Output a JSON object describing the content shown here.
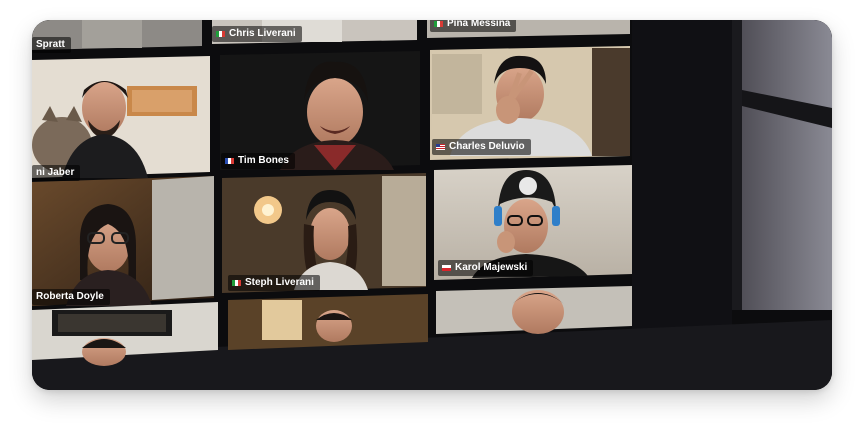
{
  "photo": {
    "subject": "video-call-grid-on-screen"
  },
  "participants": [
    {
      "name": "Spratt",
      "flag": "none"
    },
    {
      "name": "Chris Liverani",
      "flag": "it"
    },
    {
      "name": "Pina Messina",
      "flag": "it"
    },
    {
      "name": "ni Jaber",
      "flag": "none"
    },
    {
      "name": "Tim Bones",
      "flag": "fr"
    },
    {
      "name": "Charles Deluvio",
      "flag": "us"
    },
    {
      "name": "Roberta Doyle",
      "flag": "none"
    },
    {
      "name": "Steph Liverani",
      "flag": "it"
    },
    {
      "name": "Karol Majewski",
      "flag": "pl"
    }
  ],
  "colors": {
    "screen_bezel": "#0b0b0c",
    "label_text": "#ffffff",
    "label_background": "rgba(0,0,0,0.55)",
    "page_background": "#ffffff"
  }
}
